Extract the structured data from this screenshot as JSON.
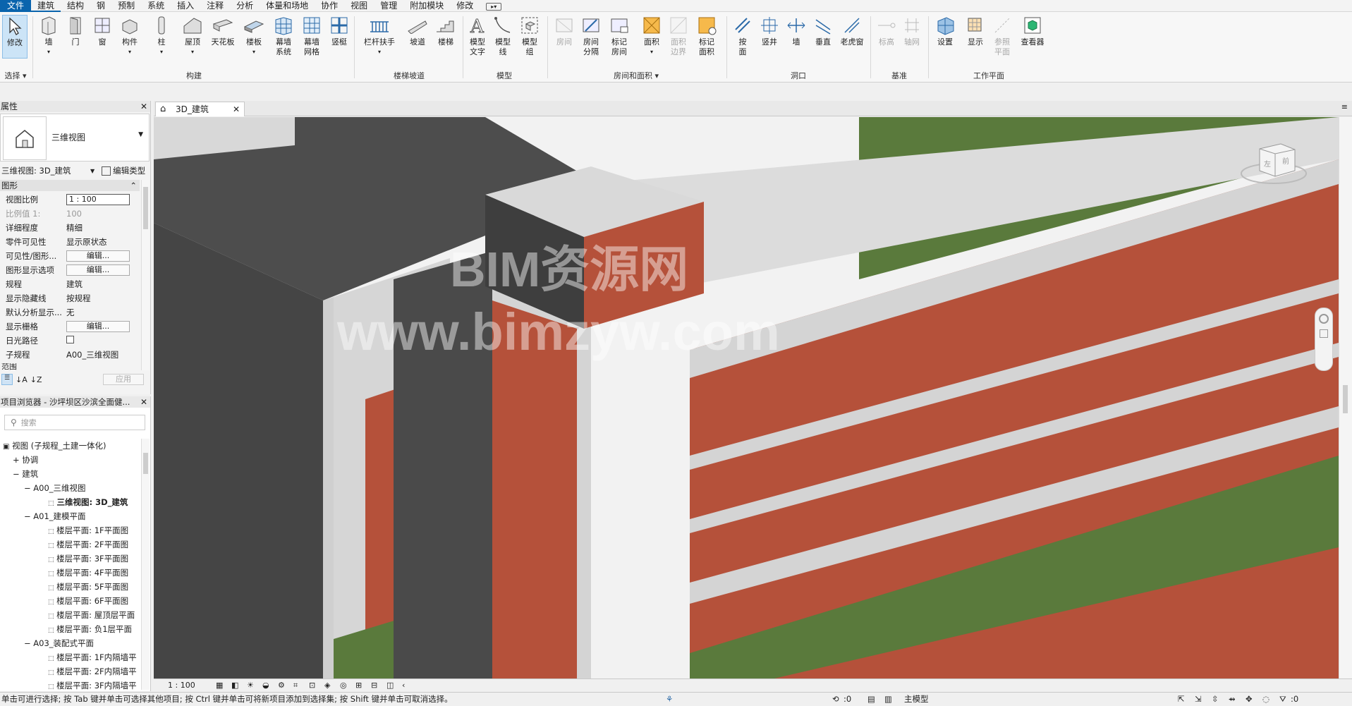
{
  "menu": [
    "文件",
    "建筑",
    "结构",
    "钢",
    "预制",
    "系统",
    "插入",
    "注释",
    "分析",
    "体量和场地",
    "协作",
    "视图",
    "管理",
    "附加模块",
    "修改"
  ],
  "ribbon": {
    "tools": [
      {
        "label": "修改",
        "sub": ""
      },
      {
        "label": "墙",
        "sub": ""
      },
      {
        "label": "门",
        "sub": ""
      },
      {
        "label": "窗",
        "sub": ""
      },
      {
        "label": "构件",
        "sub": ""
      },
      {
        "label": "柱",
        "sub": ""
      },
      {
        "label": "屋顶",
        "sub": ""
      },
      {
        "label": "天花板",
        "sub": ""
      },
      {
        "label": "楼板",
        "sub": ""
      },
      {
        "label": "幕墙",
        "sub": "系统"
      },
      {
        "label": "幕墙",
        "sub": "网格"
      },
      {
        "label": "竖梃",
        "sub": ""
      },
      {
        "label": "栏杆扶手",
        "sub": ""
      },
      {
        "label": "坡道",
        "sub": ""
      },
      {
        "label": "楼梯",
        "sub": ""
      },
      {
        "label": "模型",
        "sub": "文字"
      },
      {
        "label": "模型",
        "sub": "线"
      },
      {
        "label": "模型",
        "sub": "组"
      },
      {
        "label": "房间",
        "sub": ""
      },
      {
        "label": "房间",
        "sub": "分隔"
      },
      {
        "label": "标记",
        "sub": "房间"
      },
      {
        "label": "面积",
        "sub": ""
      },
      {
        "label": "面积",
        "sub": "边界"
      },
      {
        "label": "标记",
        "sub": "面积"
      },
      {
        "label": "按",
        "sub": "面"
      },
      {
        "label": "竖井",
        "sub": ""
      },
      {
        "label": "墙",
        "sub": ""
      },
      {
        "label": "垂直",
        "sub": ""
      },
      {
        "label": "老虎窗",
        "sub": ""
      },
      {
        "label": "标高",
        "sub": ""
      },
      {
        "label": "轴网",
        "sub": ""
      },
      {
        "label": "设置",
        "sub": ""
      },
      {
        "label": "显示",
        "sub": ""
      },
      {
        "label": "参照",
        "sub": "平面"
      },
      {
        "label": "查看器",
        "sub": ""
      }
    ],
    "groups": [
      "选择",
      "构建",
      "楼梯坡道",
      "模型",
      "房间和面积",
      "洞口",
      "基准",
      "工作平面"
    ]
  },
  "properties": {
    "title": "属性",
    "type_name": "三维视图",
    "instance": "三维视图: 3D_建筑",
    "edit_type": "编辑类型",
    "section_graphics": "图形",
    "rows": [
      {
        "k": "视图比例",
        "v": "1 : 100"
      },
      {
        "k": "比例值 1:",
        "v": "100"
      },
      {
        "k": "详细程度",
        "v": "精细"
      },
      {
        "k": "零件可见性",
        "v": "显示原状态"
      },
      {
        "k": "可见性/图形...",
        "v": "编辑..."
      },
      {
        "k": "图形显示选项",
        "v": "编辑..."
      },
      {
        "k": "规程",
        "v": "建筑"
      },
      {
        "k": "显示隐藏线",
        "v": "按规程"
      },
      {
        "k": "默认分析显示...",
        "v": "无"
      },
      {
        "k": "显示栅格",
        "v": "编辑..."
      },
      {
        "k": "日光路径",
        "v": ""
      },
      {
        "k": "子规程",
        "v": "A00_三维视图"
      }
    ],
    "section_extent": "范围",
    "apply": "应用"
  },
  "browser": {
    "title": "项目浏览器 - 沙坪坝区沙滨全面健...",
    "search_placeholder": "搜索",
    "nodes": [
      {
        "t": "视图 (子规程_土建一体化)",
        "lvl": 0
      },
      {
        "t": "协调",
        "lvl": 1
      },
      {
        "t": "建筑",
        "lvl": 1
      },
      {
        "t": "A00_三维视图",
        "lvl": 2
      },
      {
        "t": "三维视图: 3D_建筑",
        "lvl": 3
      },
      {
        "t": "A01_建模平面",
        "lvl": 2
      },
      {
        "t": "楼层平面: 1F平面图",
        "lvl": 3
      },
      {
        "t": "楼层平面: 2F平面图",
        "lvl": 3
      },
      {
        "t": "楼层平面: 3F平面图",
        "lvl": 3
      },
      {
        "t": "楼层平面: 4F平面图",
        "lvl": 3
      },
      {
        "t": "楼层平面: 5F平面图",
        "lvl": 3
      },
      {
        "t": "楼层平面: 6F平面图",
        "lvl": 3
      },
      {
        "t": "楼层平面: 屋顶层平面",
        "lvl": 3
      },
      {
        "t": "楼层平面: 负1层平面",
        "lvl": 3
      },
      {
        "t": "A03_装配式平面",
        "lvl": 2
      },
      {
        "t": "楼层平面: 1F内隔墙平",
        "lvl": 3
      },
      {
        "t": "楼层平面: 2F内隔墙平",
        "lvl": 3
      },
      {
        "t": "楼层平面: 3F内隔墙平",
        "lvl": 3
      }
    ]
  },
  "view_tab": "3D_建筑",
  "watermark": {
    "line1": "BIM资源网",
    "line2": "www.bimzyw.com"
  },
  "viewcube": {
    "left": "左",
    "front": "前"
  },
  "view_scale": "1 : 100",
  "status": {
    "message": "单击可进行选择; 按 Tab 键并单击可选择其他项目; 按 Ctrl 键并单击可将新项目添加到选择集; 按 Shift 键并单击可取消选择。",
    "coord": ":0",
    "model": "主模型",
    "filter": ":0"
  },
  "colors": {
    "brick": "#b5513a",
    "grass": "#5a7a3c",
    "concrete": "#d4d4d4",
    "dark": "#4a4a4a"
  }
}
